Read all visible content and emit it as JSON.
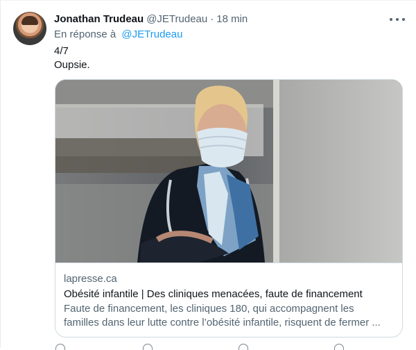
{
  "tweet": {
    "author": {
      "name": "Jonathan Trudeau",
      "handle": "@JETrudeau",
      "time": "18 min",
      "separator": "·"
    },
    "reply": {
      "label": "En réponse à",
      "handle": "@JETrudeau"
    },
    "text": [
      "4/7",
      "Oupsie."
    ],
    "card": {
      "domain": "lapresse.ca",
      "title": "Obésité infantile  | Des cliniques menacées, faute de financement",
      "description": "Faute de financement, les cliniques 180, qui accompagnent les familles dans leur lutte contre l’obésité infantile, risquent de fermer ...",
      "image_icon": "masked-nurse-photo"
    },
    "icons": {
      "avatar": "profile-photo-icon",
      "more": "more-horizontal-icon"
    }
  }
}
